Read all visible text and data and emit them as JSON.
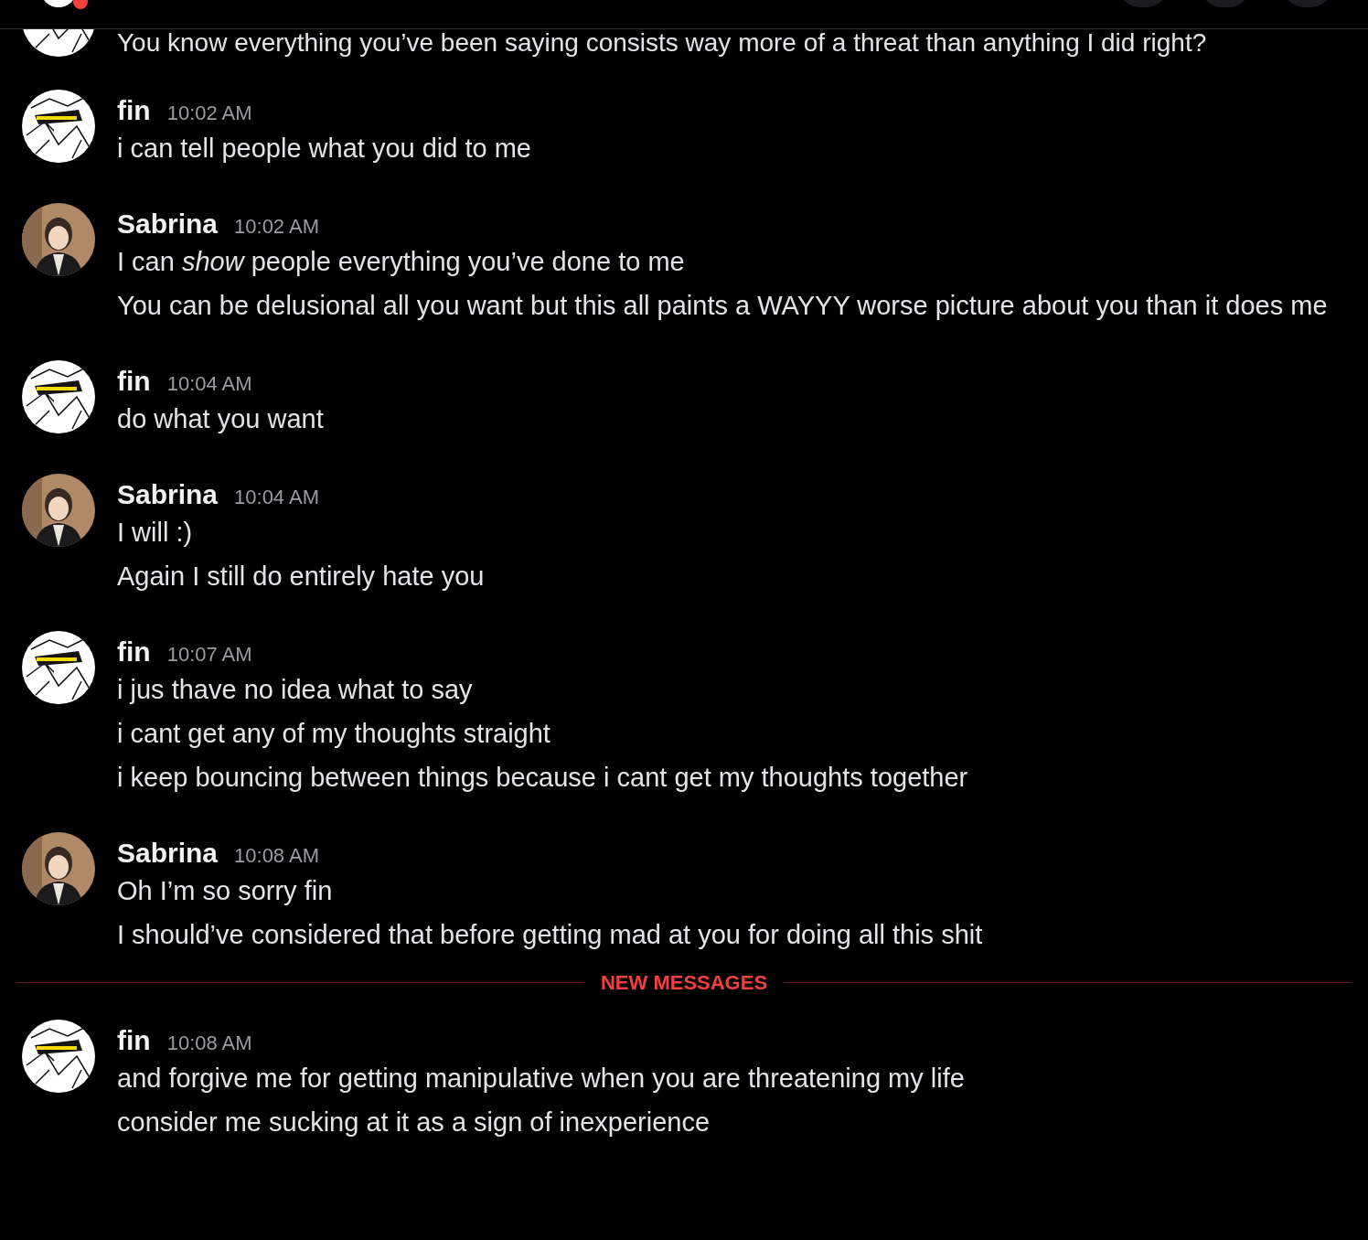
{
  "header": {
    "unread_badge": true
  },
  "partial_message": {
    "avatar": {
      "kind": "sketch"
    },
    "text": "You know everything you’ve been saying consists way more of a threat than anything I did right?"
  },
  "items": [
    {
      "kind": "message",
      "author": "fin",
      "avatar": {
        "kind": "sketch"
      },
      "time": "10:02 AM",
      "lines": [
        "i can tell people what you did to me"
      ]
    },
    {
      "kind": "message",
      "author": "Sabrina",
      "avatar": {
        "kind": "portrait"
      },
      "time": "10:02 AM",
      "lines": [
        "I can *show* people everything you’ve done to me",
        "You can be delusional all you want but this all paints a WAYYY worse picture about you than it does me"
      ]
    },
    {
      "kind": "message",
      "author": "fin",
      "avatar": {
        "kind": "sketch"
      },
      "time": "10:04 AM",
      "lines": [
        "do what you want"
      ]
    },
    {
      "kind": "message",
      "author": "Sabrina",
      "avatar": {
        "kind": "portrait"
      },
      "time": "10:04 AM",
      "lines": [
        "I will :)",
        "Again I still do entirely hate you"
      ]
    },
    {
      "kind": "message",
      "author": "fin",
      "avatar": {
        "kind": "sketch"
      },
      "time": "10:07 AM",
      "lines": [
        "i jus thave no idea what to say",
        "i cant get any of my thoughts straight",
        "i keep bouncing between things because i cant get my thoughts together"
      ]
    },
    {
      "kind": "message",
      "author": "Sabrina",
      "avatar": {
        "kind": "portrait"
      },
      "time": "10:08 AM",
      "lines": [
        "Oh I’m so sorry fin",
        "I should’ve considered that before getting mad at you for doing all this shit"
      ]
    },
    {
      "kind": "divider",
      "label": "NEW MESSAGES"
    },
    {
      "kind": "message",
      "author": "fin",
      "avatar": {
        "kind": "sketch"
      },
      "time": "10:08 AM",
      "lines": [
        "and forgive me for getting manipulative when you are threatening my life",
        "consider me sucking at it as a sign of inexperience"
      ]
    }
  ]
}
